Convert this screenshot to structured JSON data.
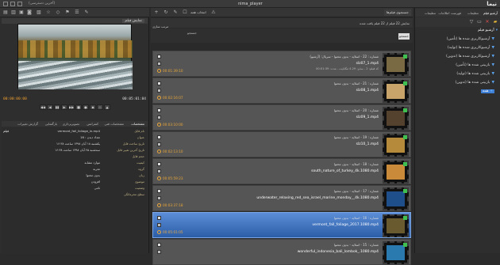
{
  "window": {
    "title": "nima_player",
    "status": "(آخرین دسترسی)",
    "logo": "نیما"
  },
  "player": {
    "tab_label": "نمایش فیلم",
    "timecode_current": "00:00:00:00",
    "timecode_total": "00:05:01:04",
    "transport": [
      "◀◀",
      "◀",
      "▮▮",
      "▶",
      "▶▶",
      "■",
      "●",
      "◆",
      "◇",
      "▲"
    ]
  },
  "properties": {
    "tabs": [
      "مشخصات",
      "مشخصات فنی",
      "کنفرانس",
      "تصویربرداری",
      "بازگشایی",
      "گزارش تغییرات"
    ],
    "section": "فیلم",
    "rows": [
      {
        "key": "نام فایل",
        "value": "vermont_fall_foliage_in.mp4"
      },
      {
        "key": "عنوان",
        "value": "تعداد دیدن : 16"
      },
      {
        "key": "تاریخ ساخت فایل",
        "value": "یکشنبه ۱۸ آبان ۱۳۹۸ ساعت ۱۶:۳۸"
      },
      {
        "key": "تاریخ آخرین تغییر فایل",
        "value": "سه‌شنبه ۲۵ آبان ۱۳۹۸ ساعت ۱۶:۳۸"
      },
      {
        "key": "حجم فایل",
        "value": ""
      },
      {
        "key": "کیفیت",
        "value": "موارد مشابه"
      },
      {
        "key": "گروه",
        "value": "تجربه"
      },
      {
        "key": "زبان",
        "value": "بدون محتوا"
      },
      {
        "key": "موضوع",
        "value": "افزودن"
      },
      {
        "key": "وضعیت",
        "value": "نامی"
      },
      {
        "key": "سطح محرمانگی",
        "value": ""
      }
    ]
  },
  "list": {
    "search_tab": "جستجوی فیلم‌ها",
    "toolbar_label": "انتخاب همه",
    "count_text": "نمایش 22 فیلم از 22 فیلم یافت شده",
    "search_label": "جستجو",
    "search_button": "جستجو",
    "sort_label": "مرتب سازی",
    "items": [
      {
        "num": "22",
        "name": "slz07_1.mp4",
        "meta": "شماره : 22 - اسلاید - بدون محتوا - سریال: (آرشیو)",
        "info": "کد فیلم: 2 - سایز: 4.29 مگابایت - مدت: 00:01:39",
        "dur": "00:01:39:10",
        "thumb": "#7a6a44",
        "sel": false
      },
      {
        "num": "21",
        "name": "slz08_1.mp4",
        "meta": "شماره : 21 - اسلاید - بدون محتوا",
        "info": "",
        "dur": "00:02:16:07",
        "thumb": "#c9a46a",
        "sel": false
      },
      {
        "num": "20",
        "name": "slz09_1.mp4",
        "meta": "شماره : 20 - اسلاید - بدون محتوا",
        "info": "",
        "dur": "00:03:10:00",
        "thumb": "#55422e",
        "sel": false
      },
      {
        "num": "19",
        "name": "slz10_1.mp4",
        "meta": "شماره : 19 - اسلاید - بدون محتوا",
        "info": "",
        "dur": "00:02:13:10",
        "thumb": "#b58a3a",
        "sel": false
      },
      {
        "num": "18",
        "name": "south_nature_of_turkey_4k.1080.mp4",
        "meta": "شماره : 18 - اسلاید - بدون محتوا",
        "info": "",
        "dur": "00:05:59:23",
        "thumb": "#c98b3a",
        "sel": false
      },
      {
        "num": "17",
        "name": "underwater_relaxing_red_sea_israel_marine_monday__4k.1080.mp4",
        "meta": "شماره : 17 - اسلاید - بدون محتوا",
        "info": "",
        "dur": "00:03:37:18",
        "thumb": "#1f4f8a",
        "sel": false
      },
      {
        "num": "16",
        "name": "vermont_fall_foliage_2017.1080.mp4",
        "meta": "شماره : 16 - اسلاید - بدون محتوا",
        "info": "",
        "dur": "00:05:01:05",
        "thumb": "#6a5a30",
        "sel": true
      },
      {
        "num": "15",
        "name": "wonderful_indonesia_bali_lombok_.1080.mp4",
        "meta": "شماره : 15 - اسلاید - بدون محتوا",
        "info": "",
        "dur": "",
        "thumb": "#2a7ab0",
        "sel": false
      }
    ]
  },
  "sidebar": {
    "tabs": [
      "آرشیو فیلم",
      "تنظیمات",
      "فهرست اطلاعات",
      "تنظیمات"
    ],
    "items": [
      {
        "label": "آرشیو فیلم",
        "root": true
      },
      {
        "label": "آرشیوکاربری شده ها (تأمین)",
        "root": false
      },
      {
        "label": "آرشیوکاربری شده ها (تولید)",
        "root": false
      },
      {
        "label": "آرشیوکاربری شده ها (تدوین)",
        "root": false
      },
      {
        "label": "بازبینی شده ها (تأمین)",
        "root": false
      },
      {
        "label": "بازبینی شده ها (تولید)",
        "root": false
      },
      {
        "label": "بازبینی شده ها (تدوین)",
        "root": false
      },
      {
        "label": "همه",
        "root": false
      }
    ]
  }
}
